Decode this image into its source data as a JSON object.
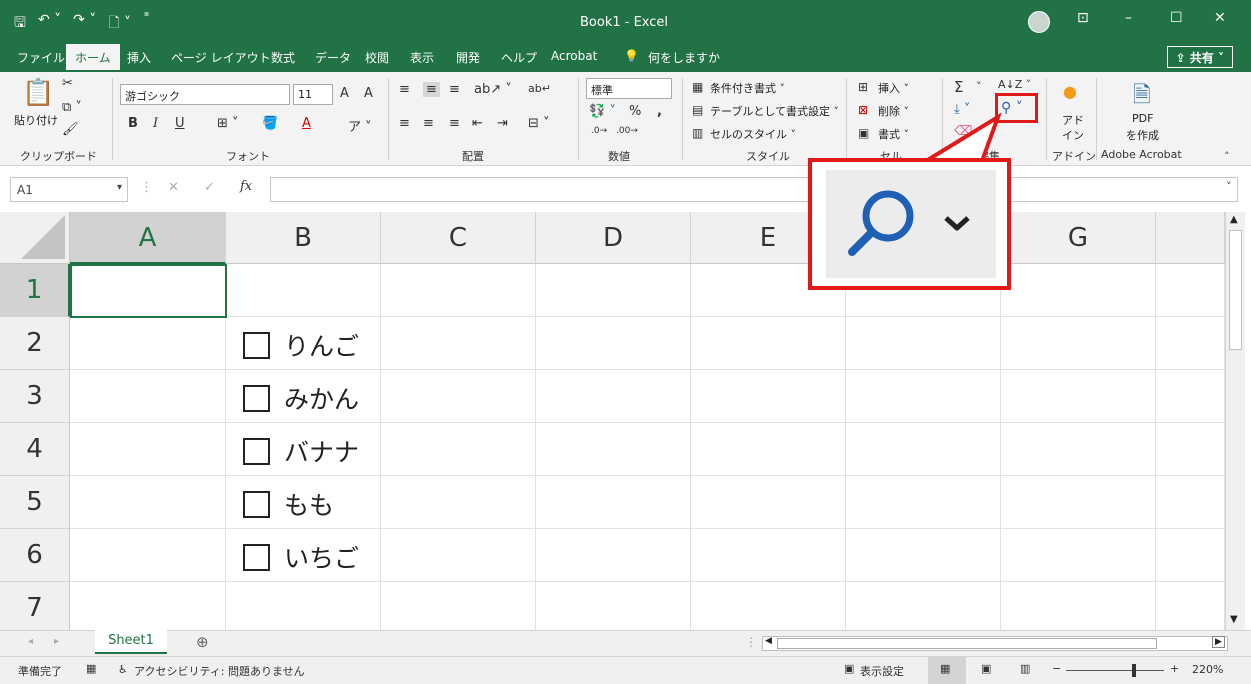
{
  "titlebar": {
    "title": "Book1  -  Excel",
    "qa_icons": [
      "save-icon",
      "undo-icon",
      "redo-icon",
      "new-doc-icon",
      "customize-icon"
    ],
    "win_buttons": {
      "ribbon_display": "⊡",
      "minimize": "–",
      "maximize": "☐",
      "close": "✕"
    }
  },
  "tabs": [
    "ファイル",
    "ホーム",
    "挿入",
    "ページ レイアウト",
    "数式",
    "データ",
    "校閲",
    "表示",
    "開発",
    "ヘルプ",
    "Acrobat",
    "何をしますか"
  ],
  "share_label": "共有",
  "ribbon": {
    "clipboard": {
      "paste": "貼り付け",
      "label": "クリップボード"
    },
    "font": {
      "name": "游ゴシック",
      "size": "11",
      "label": "フォント",
      "bold": "B",
      "italic": "I",
      "underline": "U",
      "grow": "A",
      "shrink": "A",
      "color": "A"
    },
    "align": {
      "label": "配置"
    },
    "number": {
      "format": "標準",
      "label": "数値",
      "percent": "%",
      "comma": ","
    },
    "styles": {
      "cond": "条件付き書式",
      "table": "テーブルとして書式設定",
      "cell": "セルのスタイル",
      "label": "スタイル"
    },
    "cells": {
      "insert": "挿入",
      "delete": "削除",
      "format": "書式",
      "label": "セル"
    },
    "edit": {
      "sigma": "Σ",
      "label": "編集"
    },
    "addin": {
      "text1": "アド",
      "text2": "イン",
      "label": "アドイン"
    },
    "acrobat": {
      "text1": "PDF",
      "text2": "を作成",
      "label": "Adobe Acrobat"
    }
  },
  "formula": {
    "namebox": "A1",
    "fx": "fx",
    "value": ""
  },
  "columns": [
    "A",
    "B",
    "C",
    "D",
    "E",
    "F",
    "G"
  ],
  "rows": [
    "1",
    "2",
    "3",
    "4",
    "5",
    "6",
    "7"
  ],
  "checklist": [
    "りんご",
    "みかん",
    "バナナ",
    "もも",
    "いちご"
  ],
  "sheet": {
    "name": "Sheet1",
    "add": "⊕"
  },
  "status": {
    "ready": "準備完了",
    "accessibility": "アクセシビリティ: 問題ありません",
    "display_settings": "表示設定",
    "zoom": "220%",
    "minus": "−",
    "plus": "+"
  },
  "colors": {
    "excel_green": "#217346",
    "callout_red": "#e01919",
    "search_blue": "#1f5fb4"
  }
}
